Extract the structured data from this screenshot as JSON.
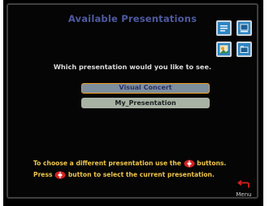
{
  "title": "Available Presentations",
  "prompt": "Which presentation would you like to see.",
  "presentations": [
    {
      "label": "Visual Concert",
      "selected": true
    },
    {
      "label": "My_Presentation",
      "selected": false
    }
  ],
  "help": {
    "line1_a": "To choose a different presentation use the",
    "line1_b": "buttons.",
    "line2_a": "Press",
    "line2_b": "button to select the current presentation."
  },
  "menu_label": "Menu",
  "icons": [
    "slides-icon",
    "presentation-icon",
    "photo-icon",
    "folder-icon",
    "navigation-pad-icon",
    "return-arrow-icon"
  ],
  "colors": {
    "title": "#4e5aa0",
    "help_text": "#f0c64a",
    "selected_border": "#f09a1f",
    "nav_red": "#d81f1f"
  }
}
